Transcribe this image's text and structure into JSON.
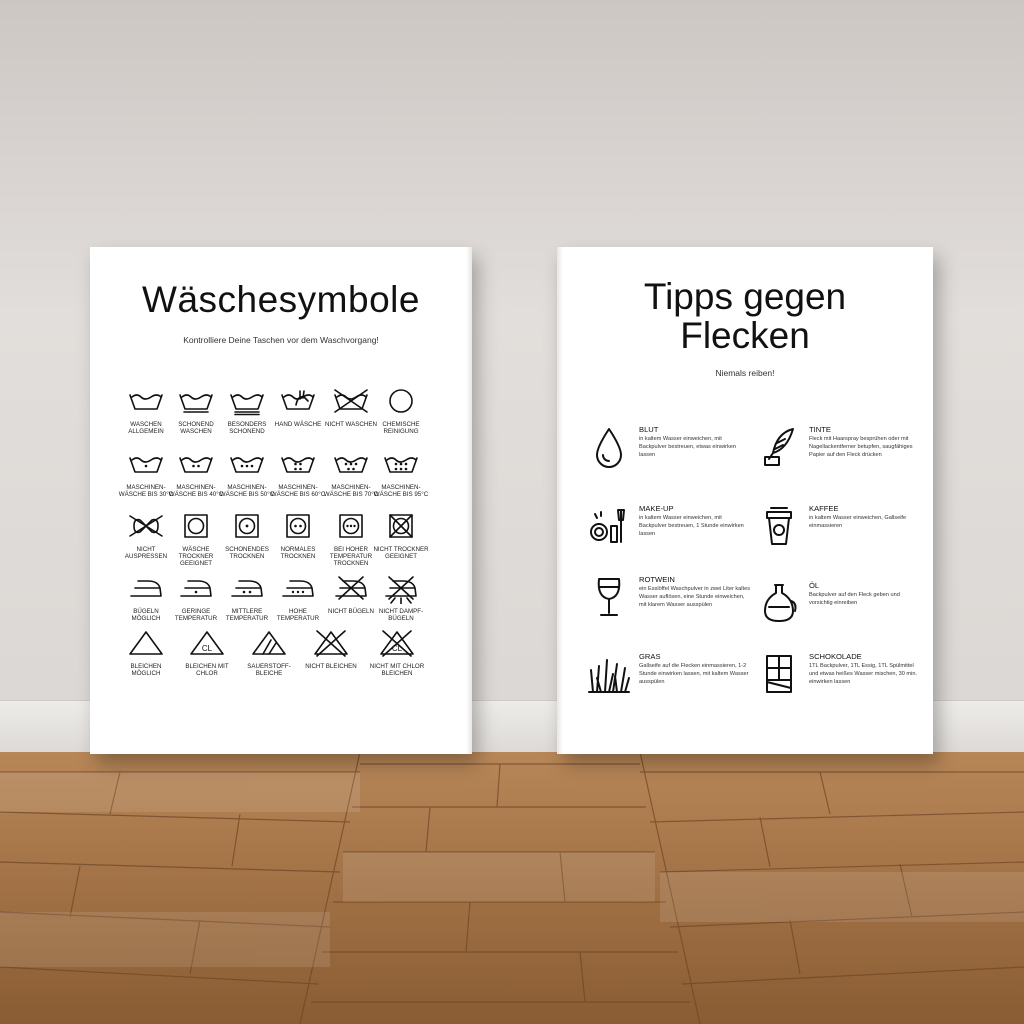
{
  "left_poster": {
    "title": "Wäschesymbole",
    "subtitle": "Kontrolliere Deine Taschen vor dem Waschvorgang!",
    "rows": [
      [
        {
          "icon": "tub-icon",
          "label": "Waschen allgemein"
        },
        {
          "icon": "tub-gentle-icon",
          "label": "Schonend waschen"
        },
        {
          "icon": "tub-very-gentle-icon",
          "label": "Besonders schonend"
        },
        {
          "icon": "hand-wash-icon",
          "label": "Hand wäsche"
        },
        {
          "icon": "no-wash-icon",
          "label": "Nicht waschen"
        },
        {
          "icon": "circle-icon",
          "label": "Chemische Reinigung"
        }
      ],
      [
        {
          "icon": "tub-1-dot-icon",
          "label": "Maschinen- wäsche bis 30°C"
        },
        {
          "icon": "tub-2-dots-icon",
          "label": "Maschinen- wäsche bis 40°C"
        },
        {
          "icon": "tub-3-dots-icon",
          "label": "Maschinen- wäsche bis 50°C"
        },
        {
          "icon": "tub-4-dots-icon",
          "label": "Maschinen- wäsche bis 60°C"
        },
        {
          "icon": "tub-5-dots-icon",
          "label": "Maschinen- wäsche bis 70°C"
        },
        {
          "icon": "tub-6-dots-icon",
          "label": "Maschinen- wäsche bis 95°C"
        }
      ],
      [
        {
          "icon": "no-wring-icon",
          "label": "Nicht auspressen"
        },
        {
          "icon": "tumble-dryer-icon",
          "label": "Wäsche trockner geeignet"
        },
        {
          "icon": "tumble-gentle-icon",
          "label": "Schonendes trocknen"
        },
        {
          "icon": "tumble-normal-icon",
          "label": "Normales trocknen"
        },
        {
          "icon": "tumble-high-icon",
          "label": "Bei hoher Temperatur trocknen"
        },
        {
          "icon": "no-tumble-icon",
          "label": "Nicht trockner geeignet"
        }
      ],
      [
        {
          "icon": "iron-icon",
          "label": "Bügeln möglich"
        },
        {
          "icon": "iron-low-icon",
          "label": "Geringe Temperatur"
        },
        {
          "icon": "iron-medium-icon",
          "label": "Mittlere Temperatur"
        },
        {
          "icon": "iron-high-icon",
          "label": "Hohe Temperatur"
        },
        {
          "icon": "no-iron-icon",
          "label": "Nicht bügeln"
        },
        {
          "icon": "no-steam-icon",
          "label": "Nicht Dampf- bügeln"
        }
      ],
      [
        {
          "icon": "triangle-icon",
          "label": "Bleichen möglich"
        },
        {
          "icon": "triangle-cl-icon",
          "label": "Bleichen mit Chlor"
        },
        {
          "icon": "triangle-oxygen-icon",
          "label": "Sauerstoff- bleiche"
        },
        {
          "icon": "no-bleach-icon",
          "label": "Nicht bleichen"
        },
        {
          "icon": "no-chlorine-icon",
          "label": "Nicht mit Chlor bleichen"
        }
      ]
    ],
    "cl_text": "CL"
  },
  "right_poster": {
    "title_line1": "Tipps gegen",
    "title_line2": "Flecken",
    "subtitle": "Niemals reiben!",
    "tips": [
      {
        "icon": "drop-icon",
        "title": "BLUT",
        "text": "in kaltem Wasser einweichen, mit Backpulver bestreuen, etwas einwirken lassen"
      },
      {
        "icon": "quill-ink-icon",
        "title": "TINTE",
        "text": "Fleck mit Haarspray besprühen oder mit Nagellackentferner betupfen, saugfähiges Papier auf den Fleck drücken"
      },
      {
        "icon": "makeup-icon",
        "title": "MAKE-UP",
        "text": "in kaltem Wasser einweichen, mit Backpulver bestreuen, 1 Stunde einwirken lassen"
      },
      {
        "icon": "coffee-cup-icon",
        "title": "KAFFEE",
        "text": "in kaltem Wasser einweichen, Gallseife einmassieren"
      },
      {
        "icon": "wine-glass-icon",
        "title": "ROTWEIN",
        "text": "ein Esslöffel Waschpulver in zwei Liter kaltes Wasser auflösen, eine Stunde einweichen, mit klarem Wasser ausspülen"
      },
      {
        "icon": "oil-bottle-icon",
        "title": "ÖL",
        "text": "Backpulver auf den Fleck geben und vorsichtig einreiben"
      },
      {
        "icon": "grass-icon",
        "title": "GRAS",
        "text": "Gallseife auf die Flecken einmassieren, 1-2 Stunde einwirken lassen, mit kaltem Wasser ausspülen"
      },
      {
        "icon": "chocolate-icon",
        "title": "SCHOKOLADE",
        "text": "1TL Backpulver, 1TL Essig, 1TL Spülmittel und etwas heißes Wasser mischen, 30 min. einwirken lassen"
      }
    ]
  },
  "colors": {
    "ink": "#111111",
    "wall": "#dcd8d5",
    "floor": "#9d6e42",
    "canvas": "#ffffff"
  }
}
